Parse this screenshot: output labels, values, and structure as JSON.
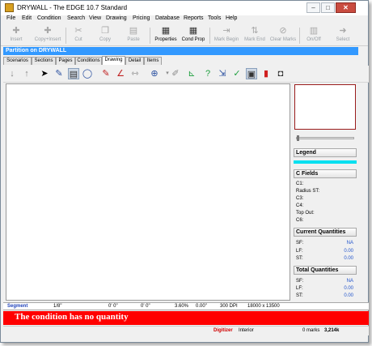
{
  "window": {
    "title": "DRYWALL - The EDGE 10.7 Standard"
  },
  "menu": [
    "File",
    "Edit",
    "Condition",
    "Search",
    "View",
    "Drawing",
    "Pricing",
    "Database",
    "Reports",
    "Tools",
    "Help"
  ],
  "toolbar": {
    "insert": "Insert",
    "copy_insert": "Copy+Insert",
    "cut": "Cut",
    "copy": "Copy",
    "paste": "Paste",
    "properties": "Properties",
    "cond_prop": "Cond Prop",
    "mark_begin": "Mark Begin",
    "mark_end": "Mark End",
    "clear_marks": "Clear Marks",
    "on_off": "On/Off",
    "select": "Select"
  },
  "section_title": "Partition on DRYWALL",
  "tabs": [
    "Scenarios",
    "Sections",
    "Pages",
    "Conditions",
    "Drawing",
    "Detail",
    "Items"
  ],
  "active_tab": "Drawing",
  "legend_label": "Legend",
  "c_fields": {
    "header": "C Fields",
    "labels": [
      "C1:",
      "Radius ST:",
      "C3:",
      "C4:",
      "Top Out:",
      "C6:"
    ]
  },
  "current_quantities": {
    "header": "Current Quantities",
    "rows": [
      {
        "label": "SF:",
        "value": "NA"
      },
      {
        "label": "LF:",
        "value": "0.00"
      },
      {
        "label": "ST:",
        "value": "0.00"
      }
    ]
  },
  "total_quantities": {
    "header": "Total Quantities",
    "rows": [
      {
        "label": "SF:",
        "value": "NA"
      },
      {
        "label": "LF:",
        "value": "0.00"
      },
      {
        "label": "ST:",
        "value": "0.00"
      }
    ]
  },
  "status": {
    "segment": "Segment",
    "scale": "1/8\"",
    "pos1": "0' 0\"",
    "pos2": "0' 0\"",
    "percent": "3.60%",
    "length": "0.00\"",
    "dpi": "300 DPI",
    "size": "18000 x 13500"
  },
  "alert": "The condition has no quantity",
  "bottom": {
    "digitizer": "Digitizer",
    "interior": "Interior",
    "marks": "0 marks",
    "memory": "3,214k"
  },
  "colors": {
    "section_bar": "#3399ff",
    "alert": "#ff0000",
    "legend_bar": "#00e0f0"
  }
}
